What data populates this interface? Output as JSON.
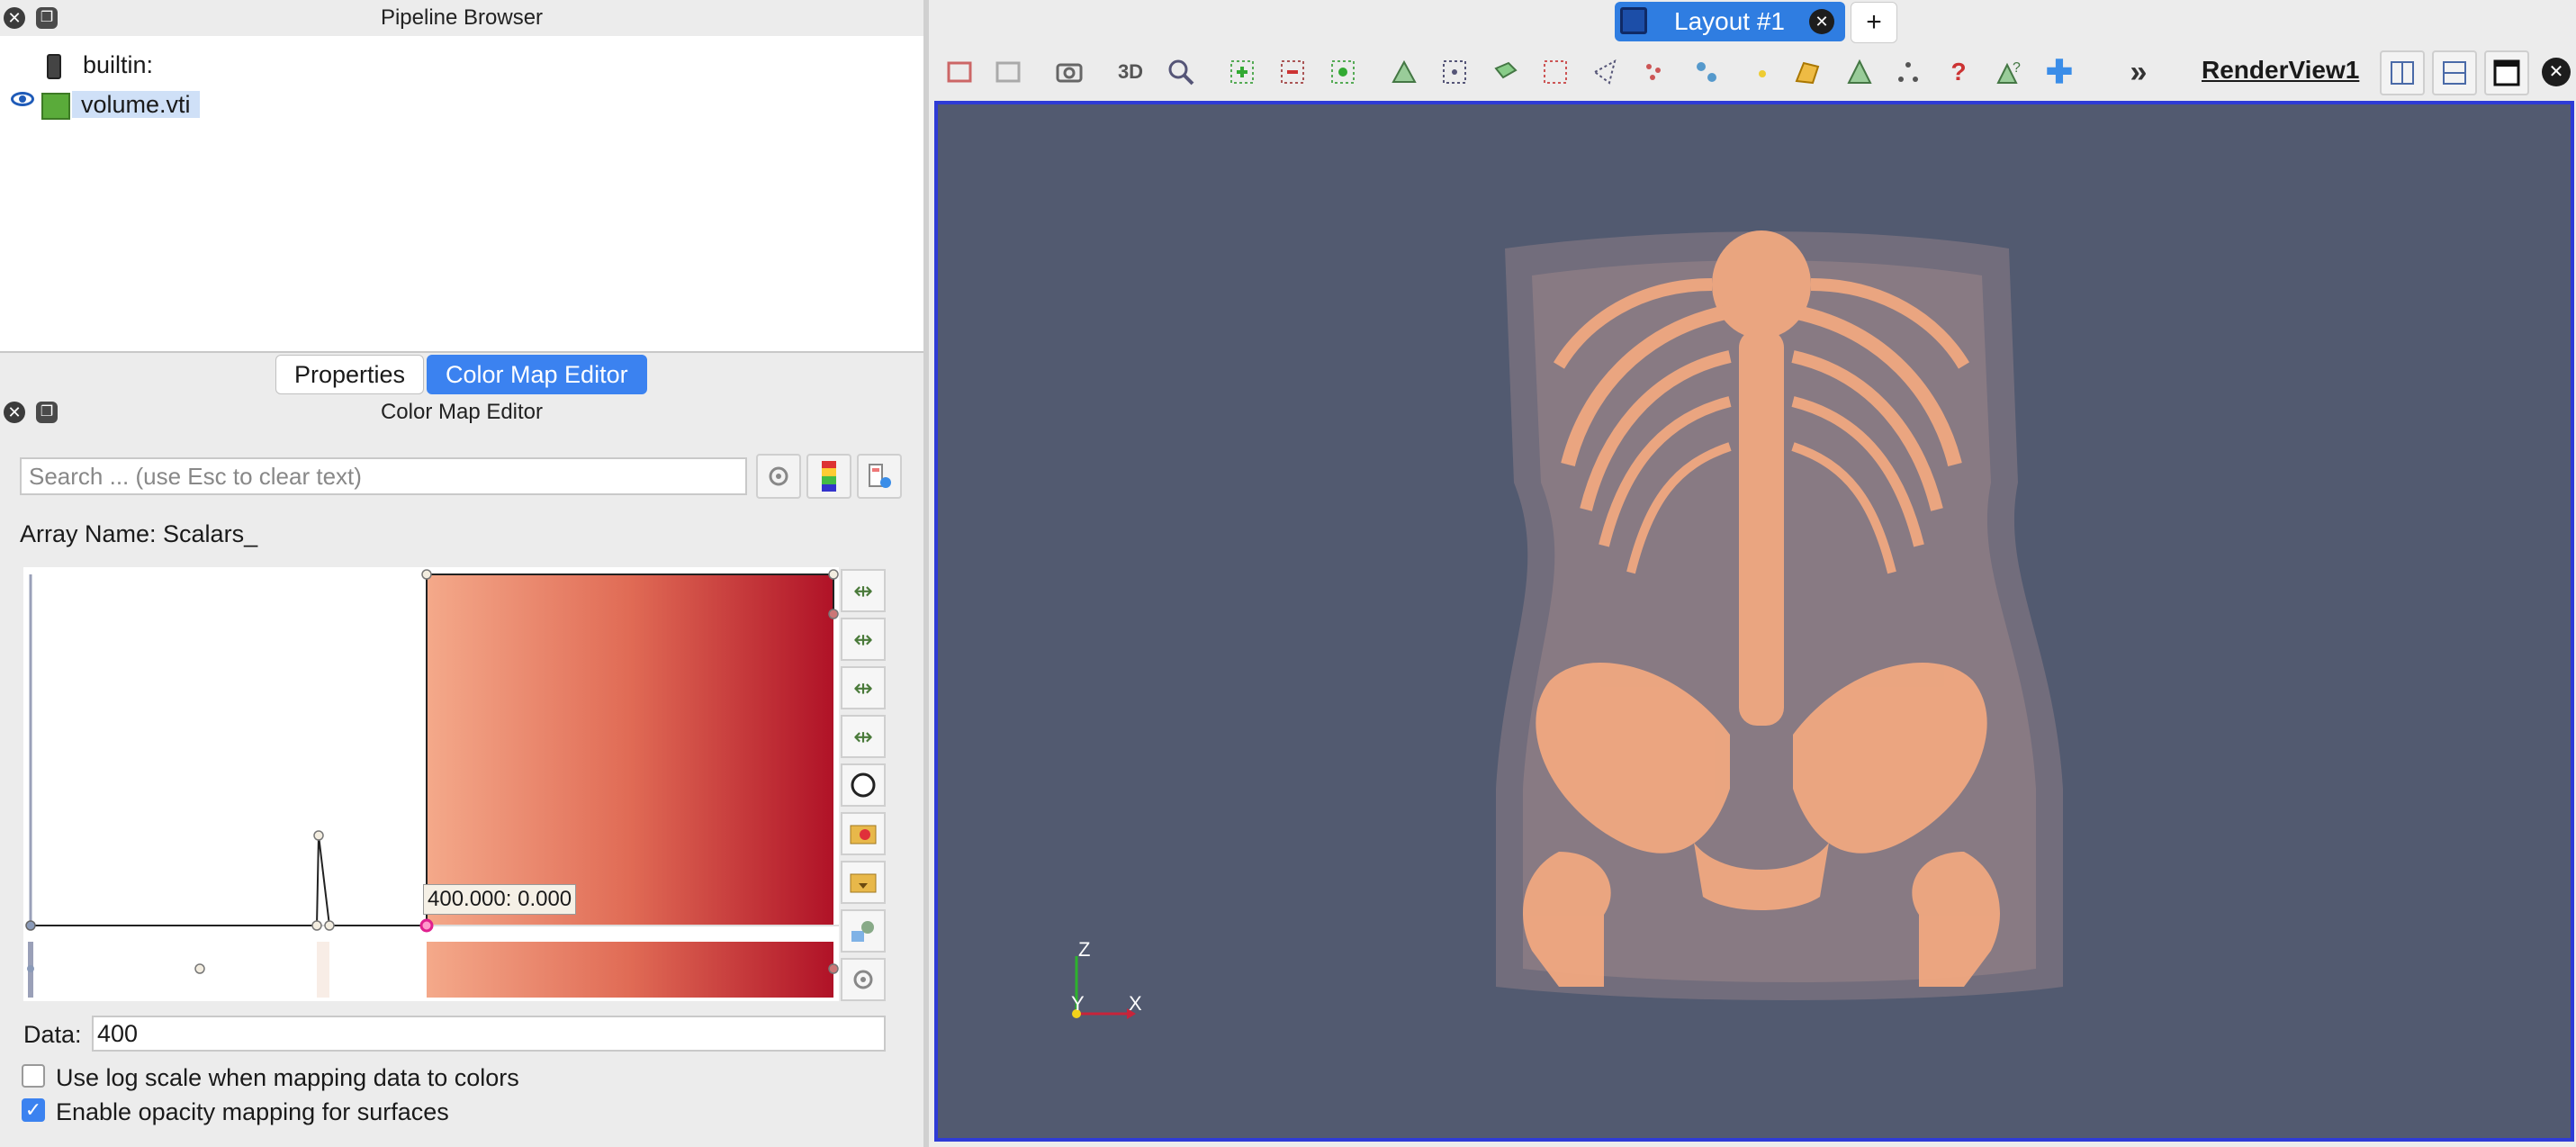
{
  "pipeline_browser": {
    "title": "Pipeline Browser",
    "items": [
      {
        "label": "builtin:",
        "icon": "server-icon"
      },
      {
        "label": "volume.vti",
        "icon": "volume-icon",
        "visible": true,
        "selected": true
      }
    ]
  },
  "tabs": [
    {
      "label": "Properties",
      "active": false
    },
    {
      "label": "Color Map Editor",
      "active": true
    }
  ],
  "color_map_editor": {
    "title": "Color Map Editor",
    "search_placeholder": "Search ... (use Esc to clear text)",
    "array_name": "Array Name: Scalars_",
    "point_tooltip": "400.000: 0.000",
    "data_label": "Data:",
    "data_value": "400",
    "log_scale": {
      "label": "Use log scale when mapping data to colors",
      "checked": false
    },
    "opacity_mapping": {
      "label": "Enable opacity mapping for surfaces",
      "checked": true
    },
    "gradient_colors": [
      "#f4a98a",
      "#e06b55",
      "#b01227"
    ]
  },
  "layout": {
    "tab_label": "Layout #1",
    "add_tab": "+",
    "view_name": "RenderView1",
    "toolbar_3d_label": "3D",
    "overflow_glyph": "»",
    "background_color": "#525a70",
    "volume_color": "#f0a880"
  },
  "axes": {
    "z": "Z",
    "y": "Y",
    "x": "X"
  }
}
